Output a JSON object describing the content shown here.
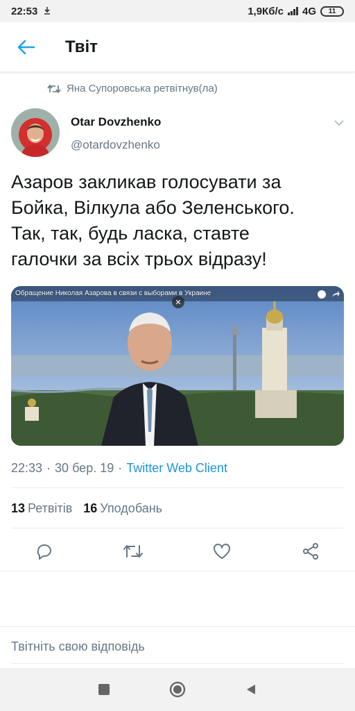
{
  "status_bar": {
    "time": "22:53",
    "speed": "1,9Кб/с",
    "network": "4G",
    "battery": "11"
  },
  "header": {
    "title": "Твіт"
  },
  "tweet": {
    "retweeted_by": "Яна Супоровська ретвітнув(ла)",
    "author_name": "Otar Dovzhenko",
    "author_handle": "@otardovzhenko",
    "text_lines": [
      "Азаров закликав голосувати за",
      "Бойка, Вілкула або Зеленського.",
      "Так, так, будь ласка, ставте",
      "галочки за всіх трьох відразу!"
    ],
    "media_title": "Обращение Николая Азарова в связи с выборами в Украине",
    "time": "22:33",
    "date": "30 бер. 19",
    "separator": "·",
    "client": "Twitter Web Client",
    "retweets_count": "13",
    "retweets_label": "Ретвітів",
    "likes_count": "16",
    "likes_label": "Уподобань"
  },
  "reply": {
    "placeholder": "Твітніть свою відповідь"
  },
  "colors": {
    "accent": "#1da1f2",
    "link": "#1b95e0",
    "secondary_text": "#657786"
  },
  "icons": [
    "back-arrow-icon",
    "retweet-icon",
    "chevron-down-icon",
    "reply-icon",
    "retweet-icon",
    "heart-icon",
    "share-icon",
    "stop-icon",
    "home-icon",
    "back-triangle-icon"
  ]
}
